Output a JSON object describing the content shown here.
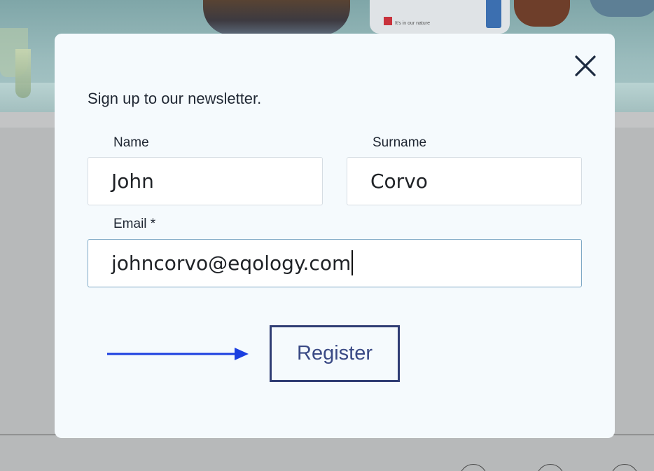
{
  "background": {
    "bottle_label": "It's in our nature"
  },
  "modal": {
    "intro": "Sign up to our newsletter.",
    "close_icon": "close-icon",
    "fields": {
      "name": {
        "label": "Name",
        "value": "John"
      },
      "surname": {
        "label": "Surname",
        "value": "Corvo"
      },
      "email": {
        "label": "Email *",
        "value": "johncorvo@eqology.com"
      }
    },
    "register_label": "Register",
    "arrow_icon": "arrow-right-icon"
  },
  "colors": {
    "modal_bg": "#f5fafd",
    "button_border": "#2f3d74",
    "arrow": "#1b3fe0"
  }
}
